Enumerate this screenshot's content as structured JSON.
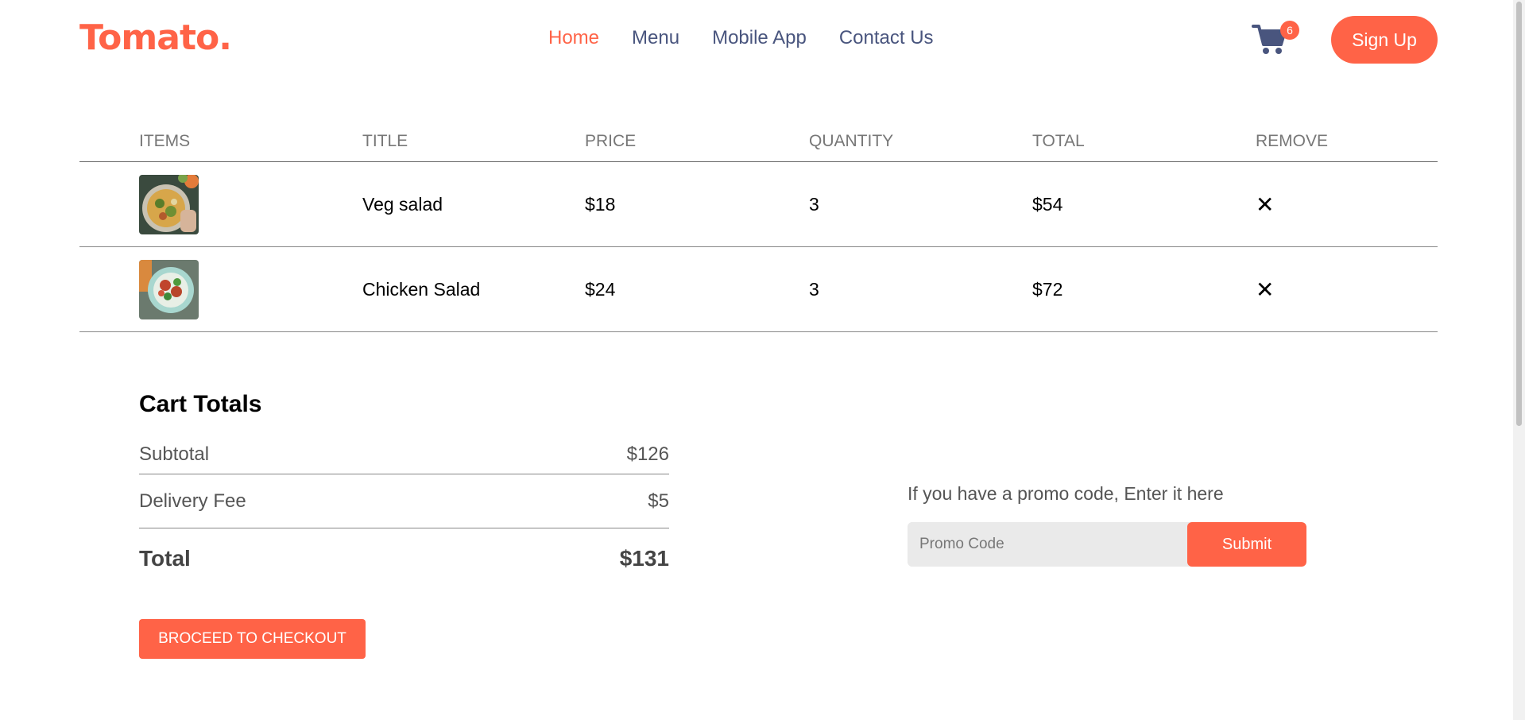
{
  "navbar": {
    "logo": "Tomato.",
    "links": [
      "Home",
      "Menu",
      "Mobile App",
      "Contact Us"
    ],
    "active_link": "Home",
    "cart_count": "6",
    "signup_label": "Sign Up"
  },
  "cart": {
    "headers": [
      "ITEMS",
      "TITLE",
      "PRICE",
      "QUANTITY",
      "TOTAL",
      "REMOVE"
    ],
    "items": [
      {
        "title": "Veg salad",
        "price": "$18",
        "quantity": "3",
        "total": "$54",
        "remove": "✕",
        "image": "veg-salad-photo"
      },
      {
        "title": "Chicken Salad",
        "price": "$24",
        "quantity": "3",
        "total": "$72",
        "remove": "✕",
        "image": "chicken-salad-photo"
      }
    ]
  },
  "totals": {
    "heading": "Cart Totals",
    "subtotal_label": "Subtotal",
    "subtotal_value": "$126",
    "delivery_label": "Delivery Fee",
    "delivery_value": "$5",
    "total_label": "Total",
    "total_value": "$131",
    "checkout_label": "BROCEED TO CHECKOUT"
  },
  "promo": {
    "prompt": "If you have a promo code, Enter it here",
    "placeholder": "Promo Code",
    "submit_label": "Submit"
  },
  "colors": {
    "accent": "#ff6347",
    "nav_text": "#49557e"
  }
}
